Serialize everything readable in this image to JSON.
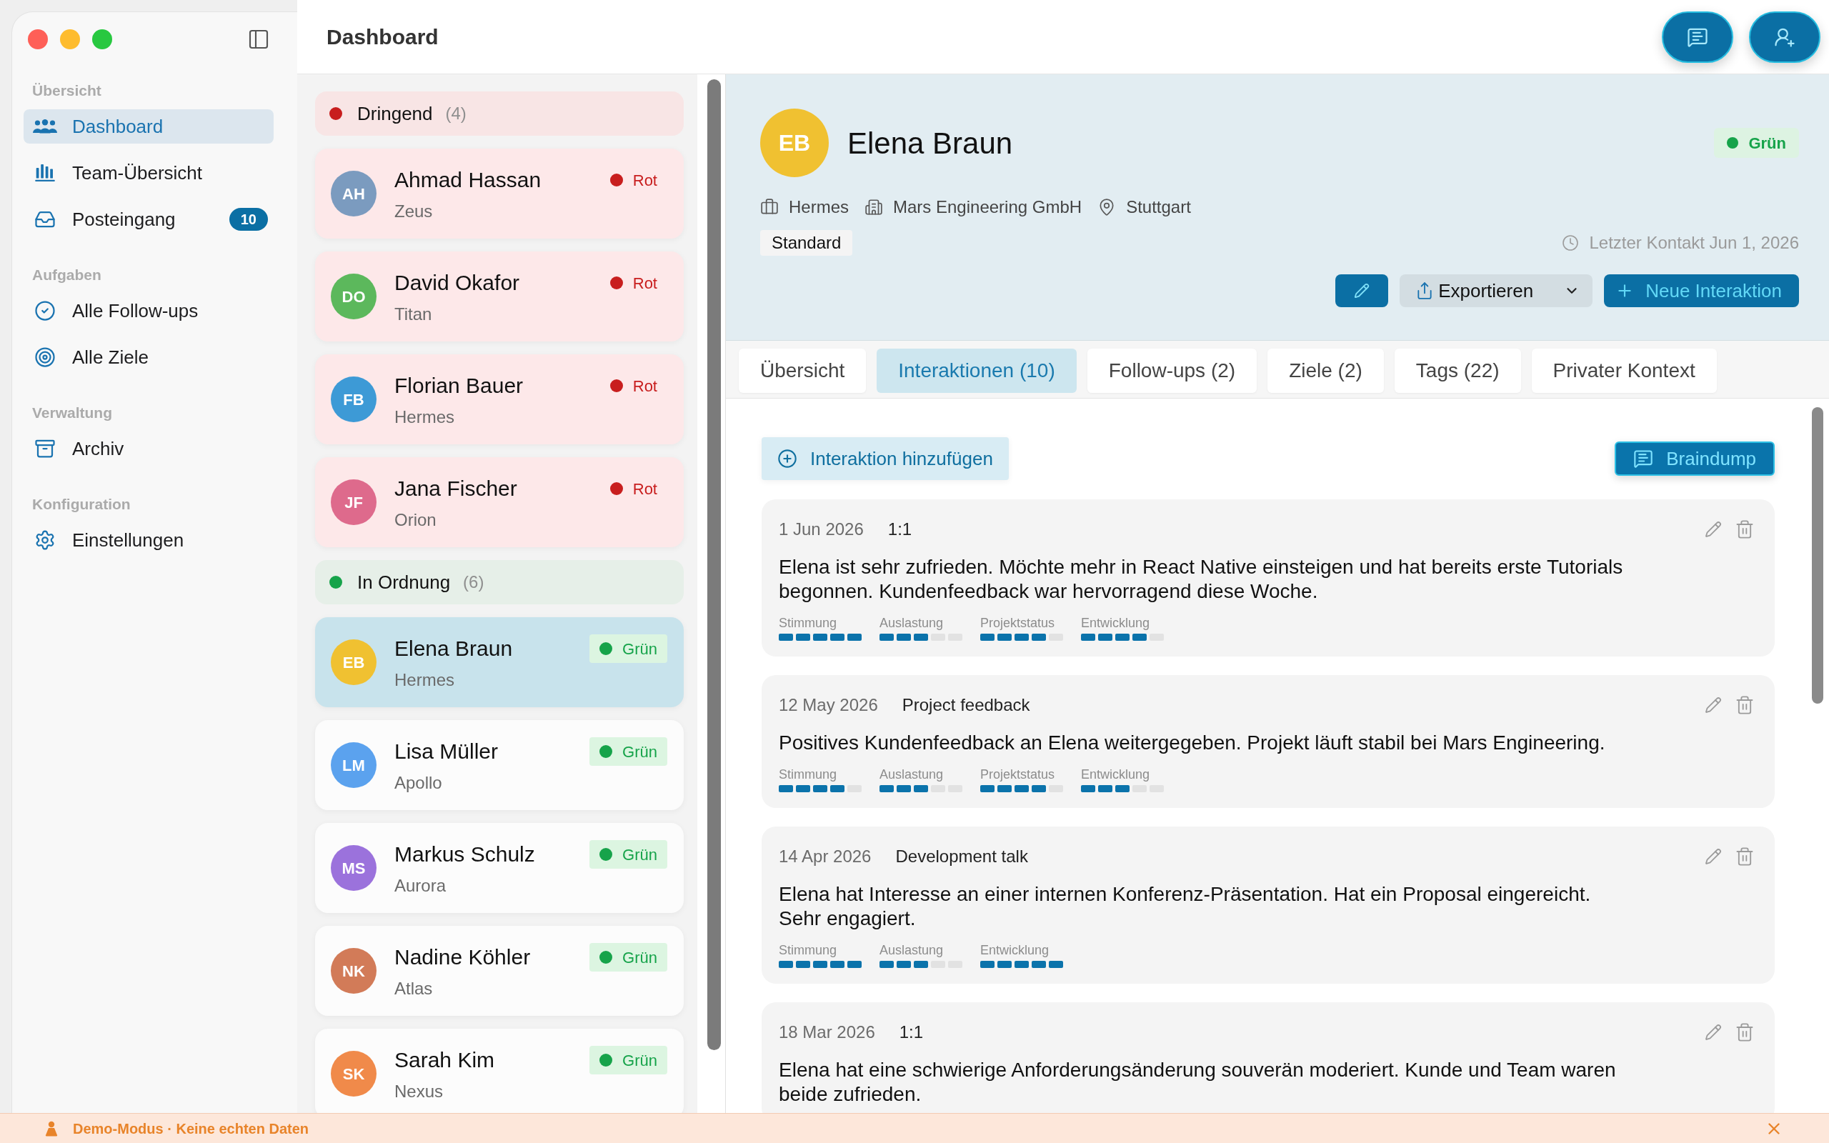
{
  "sidebar": {
    "sections": [
      {
        "title": "Übersicht",
        "items": [
          {
            "label": "Dashboard",
            "selected": true
          },
          {
            "label": "Team-Übersicht",
            "selected": false
          },
          {
            "label": "Posteingang",
            "selected": false,
            "badge": "10"
          }
        ]
      },
      {
        "title": "Aufgaben",
        "items": [
          {
            "label": "Alle Follow-ups",
            "selected": false
          },
          {
            "label": "Alle Ziele",
            "selected": false
          }
        ]
      },
      {
        "title": "Verwaltung",
        "items": [
          {
            "label": "Archiv",
            "selected": false
          }
        ]
      },
      {
        "title": "Konfiguration",
        "items": [
          {
            "label": "Einstellungen",
            "selected": false
          }
        ]
      }
    ]
  },
  "header": {
    "title": "Dashboard"
  },
  "contact_list": {
    "groups": [
      {
        "label": "Dringend",
        "count": "(4)",
        "color": "#c81e1e",
        "kind": "urgent",
        "contacts": [
          {
            "initials": "AH",
            "color": "#7b9bbf",
            "name": "Ahmad Hassan",
            "subtitle": "Zeus",
            "status": {
              "label": "Rot",
              "color": "#c81e1e"
            },
            "selected": false
          },
          {
            "initials": "DO",
            "color": "#5cb85c",
            "name": "David Okafor",
            "subtitle": "Titan",
            "status": {
              "label": "Rot",
              "color": "#c81e1e"
            },
            "selected": false
          },
          {
            "initials": "FB",
            "color": "#3d9ad6",
            "name": "Florian Bauer",
            "subtitle": "Hermes",
            "status": {
              "label": "Rot",
              "color": "#c81e1e"
            },
            "selected": false
          },
          {
            "initials": "JF",
            "color": "#de6a8c",
            "name": "Jana Fischer",
            "subtitle": "Orion",
            "status": {
              "label": "Rot",
              "color": "#c81e1e"
            },
            "selected": false
          }
        ]
      },
      {
        "label": "In Ordnung",
        "count": "(6)",
        "color": "#16a34a",
        "kind": "ok",
        "contacts": [
          {
            "initials": "EB",
            "color": "#f0c131",
            "name": "Elena Braun",
            "subtitle": "Hermes",
            "status": {
              "label": "Grün",
              "color": "#16a34a"
            },
            "selected": true
          },
          {
            "initials": "LM",
            "color": "#5ba2ee",
            "name": "Lisa Müller",
            "subtitle": "Apollo",
            "status": {
              "label": "Grün",
              "color": "#16a34a"
            },
            "selected": false
          },
          {
            "initials": "MS",
            "color": "#9b72dc",
            "name": "Markus Schulz",
            "subtitle": "Aurora",
            "status": {
              "label": "Grün",
              "color": "#16a34a"
            },
            "selected": false
          },
          {
            "initials": "NK",
            "color": "#d27b58",
            "name": "Nadine Köhler",
            "subtitle": "Atlas",
            "status": {
              "label": "Grün",
              "color": "#16a34a"
            },
            "selected": false
          },
          {
            "initials": "SK",
            "color": "#f08a4a",
            "name": "Sarah Kim",
            "subtitle": "Nexus",
            "status": {
              "label": "Grün",
              "color": "#16a34a"
            },
            "selected": false
          }
        ]
      }
    ]
  },
  "detail": {
    "initials": "EB",
    "color": "#f0c131",
    "name": "Elena Braun",
    "status": {
      "label": "Grün",
      "color": "#16a34a"
    },
    "meta": [
      "Hermes",
      "Mars Engineering GmbH",
      "Stuttgart"
    ],
    "tag": "Standard",
    "last_contact": "Letzter Kontakt Jun 1, 2026",
    "export_label": "Exportieren",
    "new_interaction_label": "Neue Interaktion",
    "tabs": [
      {
        "label": "Übersicht",
        "selected": false
      },
      {
        "label": "Interaktionen (10)",
        "selected": true
      },
      {
        "label": "Follow-ups (2)",
        "selected": false
      },
      {
        "label": "Ziele (2)",
        "selected": false
      },
      {
        "label": "Tags (22)",
        "selected": false
      },
      {
        "label": "Privater Kontext",
        "selected": false
      }
    ],
    "add_interaction_label": "Interaktion hinzufügen",
    "braindump_label": "Braindump",
    "interactions": [
      {
        "date": "1 Jun 2026",
        "type": "1:1",
        "text": "Elena ist sehr zufrieden. Möchte mehr in React Native einsteigen und hat bereits erste Tutorials begonnen. Kundenfeedback war hervorragend diese Woche.",
        "metrics": [
          {
            "label": "Stimmung",
            "stars": 5
          },
          {
            "label": "Auslastung",
            "stars": 3
          },
          {
            "label": "Projektstatus",
            "stars": 4
          },
          {
            "label": "Entwicklung",
            "stars": 4
          }
        ]
      },
      {
        "date": "12 May 2026",
        "type": "Project feedback",
        "text": "Positives Kundenfeedback an Elena weitergegeben. Projekt läuft stabil bei Mars Engineering.",
        "metrics": [
          {
            "label": "Stimmung",
            "stars": 4
          },
          {
            "label": "Auslastung",
            "stars": 3
          },
          {
            "label": "Projektstatus",
            "stars": 4
          },
          {
            "label": "Entwicklung",
            "stars": 3
          }
        ]
      },
      {
        "date": "14 Apr 2026",
        "type": "Development talk",
        "text": "Elena hat Interesse an einer internen Konferenz-Präsentation. Hat ein Proposal eingereicht. Sehr engagiert.",
        "metrics": [
          {
            "label": "Stimmung",
            "stars": 5
          },
          {
            "label": "Auslastung",
            "stars": 3
          },
          {
            "label": "Entwicklung",
            "stars": 5
          }
        ]
      },
      {
        "date": "18 Mar 2026",
        "type": "1:1",
        "text": "Elena hat eine schwierige Anforderungsänderung souverän moderiert. Kunde und Team waren beide zufrieden."
      }
    ]
  },
  "banner": {
    "text": "Demo-Modus · Keine echten Daten"
  }
}
